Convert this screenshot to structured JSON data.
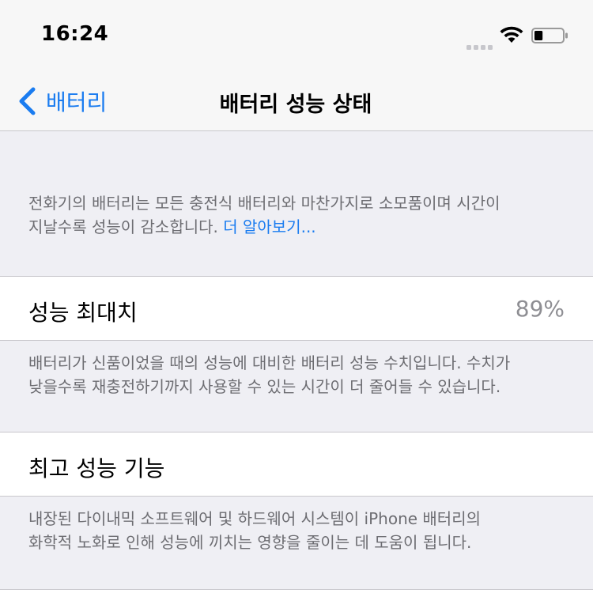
{
  "status_bar": {
    "time": "16:24"
  },
  "nav": {
    "back_label": "배터리",
    "title": "배터리 성능 상태"
  },
  "intro": {
    "line1": "전화기의 배터리는 모든 충전식 배터리와 마찬가지로 소모품이며 시간이",
    "line2_text": "지날수록 성능이 감소합니다.",
    "learn_more": "더 알아보기..."
  },
  "max_capacity": {
    "label": "성능 최대치",
    "value": "89%",
    "footer_line1": "배터리가 신품이었을 때의 성능에 대비한 배터리 성능 수치입니다. 수치가",
    "footer_line2": "낮을수록 재충전하기까지 사용할 수 있는 시간이 더 줄어들 수 있습니다."
  },
  "peak_performance": {
    "label": "최고 성능 기능",
    "footer_line1": "내장된 다이내믹 소프트웨어 및 하드웨어 시스템이 iPhone 배터리의",
    "footer_line2": "화학적 노화로 인해 성능에 끼치는 영향을 줄이는 데 도움이 됩니다."
  },
  "colors": {
    "accent": "#1a7cf0",
    "background": "#efeff4",
    "secondary_text": "#6d6d72"
  },
  "icons": {
    "back": "chevron-left-icon",
    "wifi": "wifi-icon",
    "battery": "battery-icon",
    "signal": "cellular-signal-icon"
  },
  "battery_level": 0.3
}
